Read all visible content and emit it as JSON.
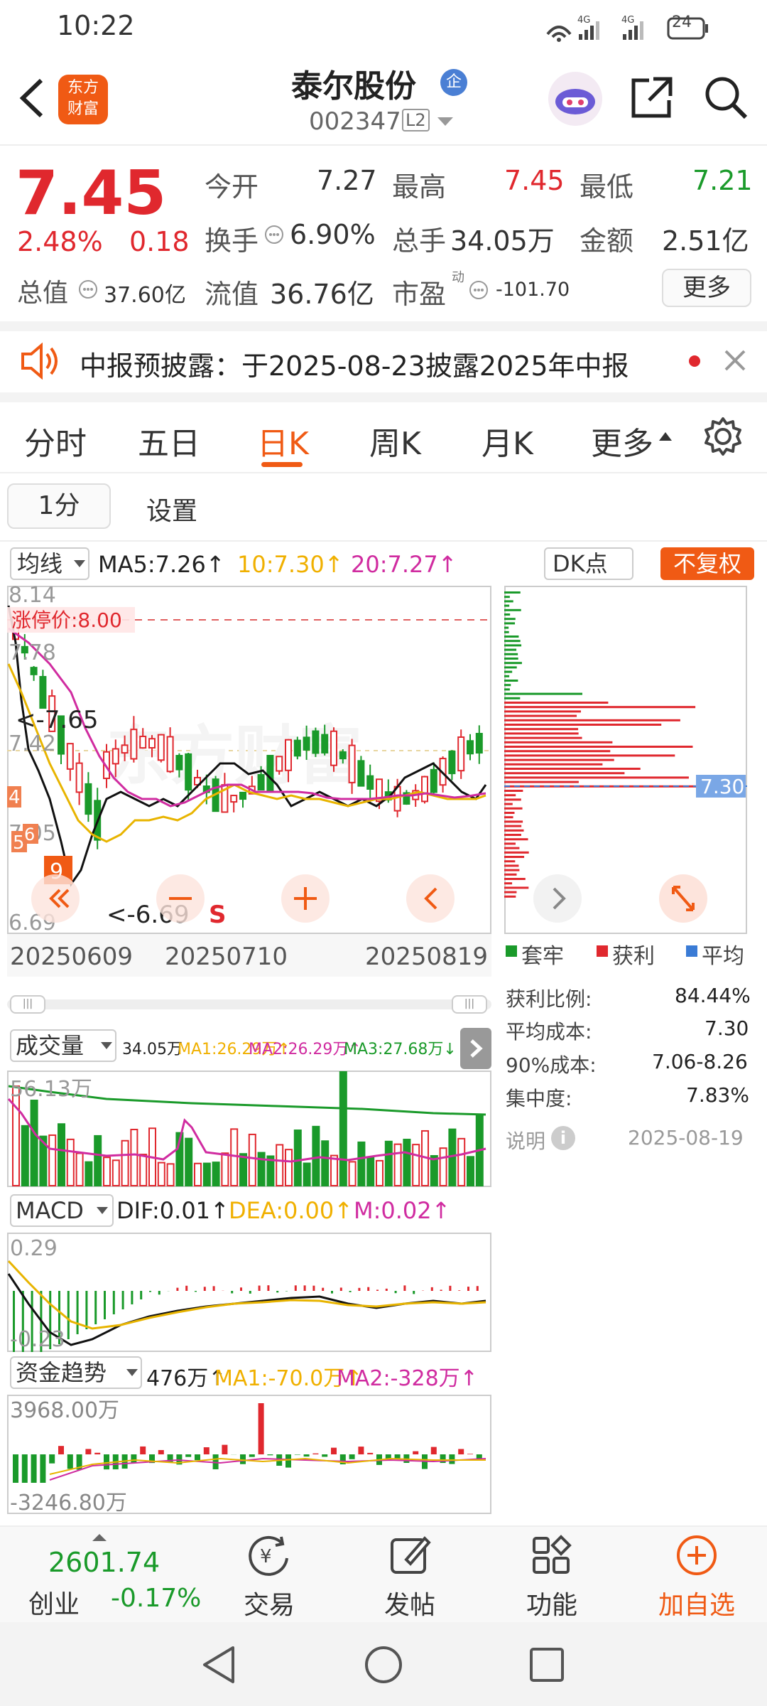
{
  "status": {
    "time": "10:22",
    "net1": "4G",
    "net2": "4G",
    "battery": "24"
  },
  "header": {
    "stock_name": "泰尔股份",
    "badge": "企",
    "code": "002347",
    "level": "L2",
    "logo_top": "东方",
    "logo_bottom": "财富"
  },
  "quote": {
    "price": "7.45",
    "change_pct": "2.48%",
    "change": "0.18",
    "open_label": "今开",
    "open": "7.27",
    "high_label": "最高",
    "high": "7.45",
    "low_label": "最低",
    "low": "7.21",
    "turnover_label": "换手",
    "turnover": "6.90%",
    "volume_label": "总手",
    "volume": "34.05万",
    "amount_label": "金额",
    "amount": "2.51亿",
    "mktcap_label": "总值",
    "mktcap": "37.60亿",
    "float_label": "流值",
    "float": "36.76亿",
    "pe_label": "市盈",
    "pe_sup": "动",
    "pe": "-101.70",
    "more": "更多"
  },
  "notice": {
    "text": "中报预披露：于2025-08-23披露2025年中报"
  },
  "tabs": [
    "分时",
    "五日",
    "日K",
    "周K",
    "月K",
    "更多"
  ],
  "subtabs": {
    "interval": "1分",
    "settings": "设置"
  },
  "ma_bar": {
    "selector": "均线",
    "ma5": "MA5:7.26↑",
    "ma10": "10:7.30↑",
    "ma20": "20:7.27↑",
    "dk": "DK点",
    "fq": "不复权"
  },
  "kline": {
    "top": "8.14",
    "limit": "涨停价:8.00",
    "l778": "7.78",
    "l742": "7.42",
    "l705": "7.05",
    "low": "6.69",
    "hi_mark": "<-7.65",
    "lo_mark": "<-6.69",
    "s_mark": "S",
    "box4": "4",
    "box5": "5",
    "box6": "6",
    "box9": "9",
    "dates": [
      "20250609",
      "20250710",
      "20250819"
    ]
  },
  "chips": {
    "avg_label": "7.30",
    "legend": [
      "套牢",
      "获利",
      "平均"
    ],
    "rows": [
      {
        "k": "获利比例:",
        "v": "84.44%"
      },
      {
        "k": "平均成本:",
        "v": "7.30"
      },
      {
        "k": "90%成本:",
        "v": "7.06-8.26"
      },
      {
        "k": "集中度:",
        "v": "7.83%"
      }
    ],
    "note": "说明",
    "date": "2025-08-19"
  },
  "volume": {
    "label": "成交量",
    "v": "34.05万",
    "ma1": "MA1:26.29万↑",
    "ma2": "MA2:26.29万↑",
    "ma3": "MA3:27.68万↓",
    "max": "56.13万"
  },
  "macd": {
    "label": "MACD",
    "dif": "DIF:0.01↑",
    "dea": "DEA:0.00↑",
    "m": "M:0.02↑",
    "top": "0.29",
    "bot": "-0.23"
  },
  "fund": {
    "label": "资金趋势",
    "v": "476万↑",
    "ma1": "MA1:-70.0万↑",
    "ma2": "MA2:-328万↑",
    "top": "3968.00万",
    "bot": "-3246.80万"
  },
  "bottom": {
    "index_value": "2601.74",
    "index_name": "创业",
    "index_chg": "-0.17%",
    "trade": "交易",
    "post": "发帖",
    "func": "功能",
    "add": "加自选"
  },
  "colors": {
    "red": "#e0282e",
    "green": "#1a9a2a",
    "orange": "#f05a14",
    "blue": "#3a7bd5"
  }
}
